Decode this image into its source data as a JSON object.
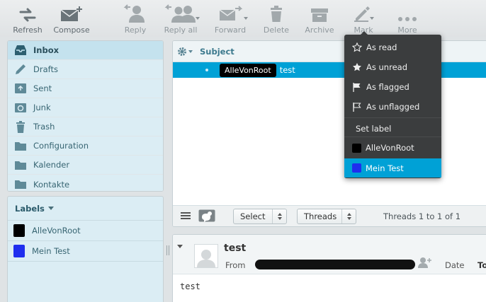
{
  "toolbar": {
    "buttons": [
      {
        "label": "Refresh",
        "icon": "refresh-icon"
      },
      {
        "label": "Compose",
        "icon": "compose-icon"
      },
      {
        "label": "Reply",
        "icon": "reply-icon"
      },
      {
        "label": "Reply all",
        "icon": "reply-all-icon"
      },
      {
        "label": "Forward",
        "icon": "forward-icon"
      },
      {
        "label": "Delete",
        "icon": "delete-icon"
      },
      {
        "label": "Archive",
        "icon": "archive-icon"
      },
      {
        "label": "Mark",
        "icon": "mark-icon"
      },
      {
        "label": "More",
        "icon": "more-icon"
      }
    ]
  },
  "folders": [
    {
      "label": "Inbox",
      "icon": "inbox-icon",
      "selected": true
    },
    {
      "label": "Drafts",
      "icon": "drafts-icon"
    },
    {
      "label": "Sent",
      "icon": "sent-icon"
    },
    {
      "label": "Junk",
      "icon": "junk-icon"
    },
    {
      "label": "Trash",
      "icon": "trash-icon"
    },
    {
      "label": "Configuration",
      "icon": "folder-icon"
    },
    {
      "label": "Kalender",
      "icon": "folder-icon"
    },
    {
      "label": "Kontakte",
      "icon": "folder-icon"
    }
  ],
  "labels": {
    "title": "Labels",
    "items": [
      {
        "label": "AlleVonRoot",
        "color": "#000000"
      },
      {
        "label": "Mein Test",
        "color": "#1f2eee"
      }
    ]
  },
  "message_list": {
    "column_subject": "Subject",
    "rows": [
      {
        "tag": "AlleVonRoot",
        "subject": "test"
      }
    ],
    "footer": {
      "select_label": "Select",
      "threads_label": "Threads",
      "count_text": "Threads 1 to 1 of 1"
    }
  },
  "preview": {
    "subject": "test",
    "from_label": "From",
    "date_label": "Date",
    "to_label": "To",
    "body": "test"
  },
  "mark_menu": {
    "items": [
      {
        "label": "As read",
        "icon": "star-outline-icon"
      },
      {
        "label": "As unread",
        "icon": "star-filled-icon"
      },
      {
        "label": "As flagged",
        "icon": "flag-filled-icon"
      },
      {
        "label": "As unflagged",
        "icon": "flag-outline-icon"
      },
      {
        "label": "Set label"
      },
      {
        "label": "AlleVonRoot",
        "color": "#000000"
      },
      {
        "label": "Mein Test",
        "color": "#1f2eee",
        "highlighted": true
      }
    ]
  },
  "colors": {
    "accent": "#00a1d6",
    "panel": "#dbedf4",
    "menu_bg": "#3b3d3e"
  }
}
